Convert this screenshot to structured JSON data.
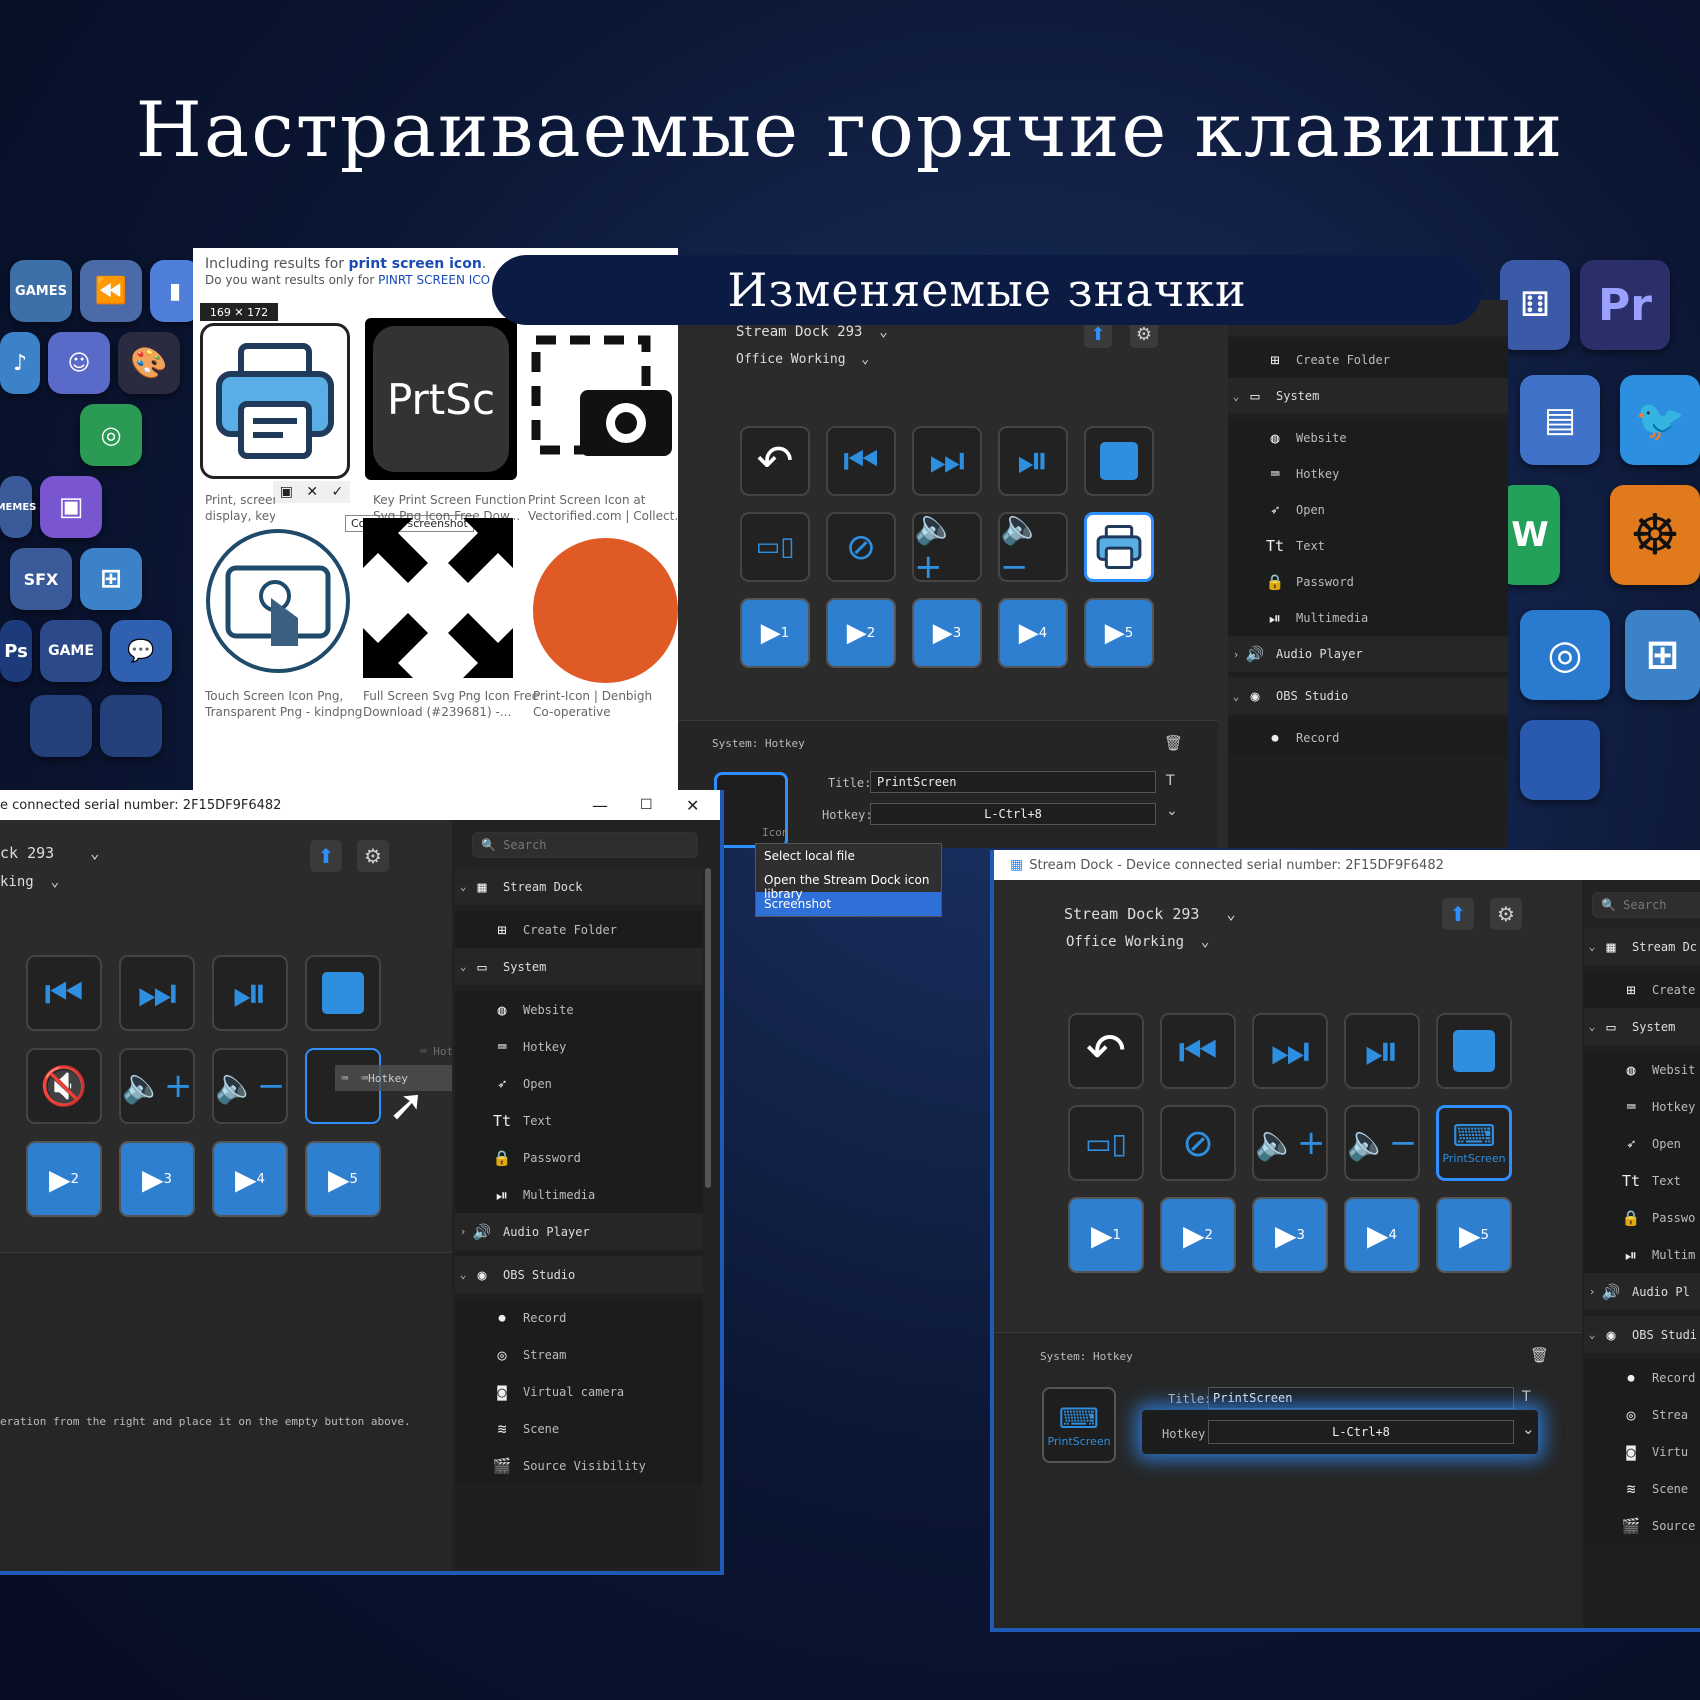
{
  "headline": "Настраиваемые горячие клавиши",
  "banner": "Изменяемые значки",
  "browser": {
    "results_line1_prefix": "Including results for ",
    "results_line1_query": "print screen icon",
    "results_line1_suffix": ".",
    "results_line2_prefix": "Do you want results only for ",
    "results_line2_query": "PINRT SCREEN ICO",
    "size_badge": "169 ✕ 172",
    "capture_tooltip": "Complete screenshot",
    "result_captions": [
      "Print, screen,\ndisplay, keys icon - Dow...",
      "Key Print Screen Function\nSvg Png Icon Free Dow...",
      "Print Screen Icon at\nVectorified.com | Collect...",
      "Touch Screen Icon Png,\nTransparent Png - kindpng",
      "Full Screen Svg Png Icon Free\nDownload (#239681) -...",
      "Print-Icon | Denbigh\nCo-operative"
    ],
    "prtsc_label": "PrtSc"
  },
  "window_back": {
    "device": "Stream Dock 293",
    "profile": "Office Working",
    "search_placeholder": "Search",
    "status_label": "System: Hotkey",
    "title_label": "Title:",
    "title_value": "PrintScreen",
    "hotkey_label": "Hotkey:",
    "hotkey_value": "L-Ctrl+8",
    "icon_label": "Icon",
    "menu": [
      "Select local file",
      "Open the Stream Dock icon library",
      "Screenshot"
    ],
    "sidebar": [
      {
        "kind": "group",
        "label": "Stream Dock",
        "icon": "keypad-icon"
      },
      {
        "kind": "child",
        "label": "Create Folder",
        "icon": "folder-plus-icon"
      },
      {
        "kind": "group",
        "label": "System",
        "icon": "monitor-icon"
      },
      {
        "kind": "child",
        "label": "Website",
        "icon": "globe-icon"
      },
      {
        "kind": "child",
        "label": "Hotkey",
        "icon": "keyboard-icon"
      },
      {
        "kind": "child",
        "label": "Open",
        "icon": "rocket-icon"
      },
      {
        "kind": "child",
        "label": "Text",
        "icon": "text-icon"
      },
      {
        "kind": "child",
        "label": "Password",
        "icon": "lock-icon"
      },
      {
        "kind": "child",
        "label": "Multimedia",
        "icon": "play-pause-icon"
      },
      {
        "kind": "group",
        "label": "Audio Player",
        "icon": "speaker-icon"
      },
      {
        "kind": "group",
        "label": "OBS Studio",
        "icon": "obs-icon"
      },
      {
        "kind": "child",
        "label": "Record",
        "icon": "rec-icon"
      }
    ]
  },
  "window_left": {
    "title": "e connected serial number:  2F15DF9F6482",
    "device": "ck 293",
    "profile": "king",
    "search_placeholder": "Search",
    "drag_label": "Hotkey",
    "drag_label_ghost": "Hotkey",
    "hint": "eration from the right and place it on the empty button above.",
    "sidebar": [
      {
        "kind": "group",
        "label": "Stream Dock",
        "icon": "keypad-icon"
      },
      {
        "kind": "child",
        "label": "Create Folder",
        "icon": "folder-plus-icon"
      },
      {
        "kind": "group",
        "label": "System",
        "icon": "monitor-icon"
      },
      {
        "kind": "child",
        "label": "Website",
        "icon": "globe-icon"
      },
      {
        "kind": "child",
        "label": "Hotkey",
        "icon": "keyboard-icon"
      },
      {
        "kind": "child",
        "label": "Open",
        "icon": "rocket-icon"
      },
      {
        "kind": "child",
        "label": "Text",
        "icon": "text-icon"
      },
      {
        "kind": "child",
        "label": "Password",
        "icon": "lock-icon"
      },
      {
        "kind": "child",
        "label": "Multimedia",
        "icon": "play-pause-icon"
      },
      {
        "kind": "group",
        "label": "Audio Player",
        "icon": "speaker-icon"
      },
      {
        "kind": "group",
        "label": "OBS Studio",
        "icon": "obs-icon"
      },
      {
        "kind": "child",
        "label": "Record",
        "icon": "rec-icon"
      },
      {
        "kind": "child",
        "label": "Stream",
        "icon": "broadcast-icon"
      },
      {
        "kind": "child",
        "label": "Virtual camera",
        "icon": "webcam-icon"
      },
      {
        "kind": "child",
        "label": "Scene",
        "icon": "layers-icon"
      },
      {
        "kind": "child",
        "label": "Source Visibility",
        "icon": "clapper-icon"
      }
    ]
  },
  "window_right": {
    "title": "Stream Dock - Device connected serial number:  2F15DF9F6482",
    "device": "Stream Dock 293",
    "profile": "Office Working",
    "search_placeholder": "Search",
    "status_label": "System: Hotkey",
    "title_label": "Title:",
    "title_value": "PrintScreen",
    "hotkey_label": "Hotkey:",
    "hotkey_value": "L-Ctrl+8",
    "key_caption": "PrintScreen",
    "sidebar": [
      {
        "kind": "group",
        "label": "Stream Dc",
        "icon": "keypad-icon"
      },
      {
        "kind": "child",
        "label": "Create",
        "icon": "folder-plus-icon"
      },
      {
        "kind": "group",
        "label": "System",
        "icon": "monitor-icon"
      },
      {
        "kind": "child",
        "label": "Websit",
        "icon": "globe-icon"
      },
      {
        "kind": "child",
        "label": "Hotkey",
        "icon": "keyboard-icon"
      },
      {
        "kind": "child",
        "label": "Open",
        "icon": "rocket-icon"
      },
      {
        "kind": "child",
        "label": "Text",
        "icon": "text-icon"
      },
      {
        "kind": "child",
        "label": "Passwo",
        "icon": "lock-icon"
      },
      {
        "kind": "child",
        "label": "Multim",
        "icon": "play-pause-icon"
      },
      {
        "kind": "group",
        "label": "Audio Pl",
        "icon": "speaker-icon"
      },
      {
        "kind": "group",
        "label": "OBS Studi",
        "icon": "obs-icon"
      },
      {
        "kind": "child",
        "label": "Record",
        "icon": "rec-icon"
      },
      {
        "kind": "child",
        "label": "Strea",
        "icon": "broadcast-icon"
      },
      {
        "kind": "child",
        "label": "Virtu",
        "icon": "webcam-icon"
      },
      {
        "kind": "child",
        "label": "Scene",
        "icon": "layers-icon"
      },
      {
        "kind": "child",
        "label": "Source",
        "icon": "clapper-icon"
      }
    ]
  },
  "video_numbers": [
    "1",
    "2",
    "3",
    "4",
    "5"
  ],
  "colors": {
    "accent": "#2f8fff",
    "key_blue": "#2e7fd0",
    "window_bg": "#2b2b2b",
    "sidebar_bg": "#1f1f1f"
  }
}
